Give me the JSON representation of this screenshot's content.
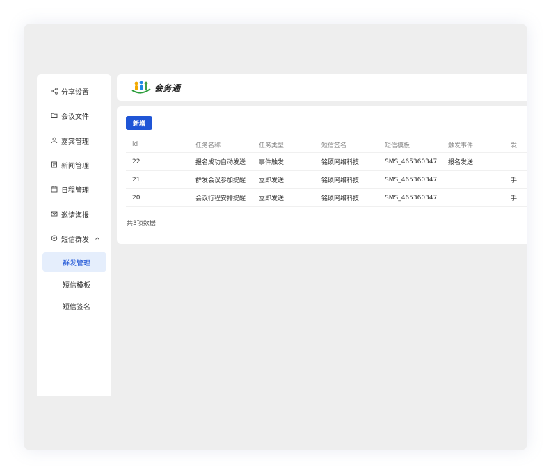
{
  "sidebar": {
    "items": [
      {
        "label": "分享设置",
        "icon": "share-icon"
      },
      {
        "label": "会议文件",
        "icon": "folder-icon"
      },
      {
        "label": "嘉宾管理",
        "icon": "user-icon"
      },
      {
        "label": "新闻管理",
        "icon": "news-icon"
      },
      {
        "label": "日程管理",
        "icon": "calendar-icon"
      },
      {
        "label": "邀请海报",
        "icon": "mail-icon"
      },
      {
        "label": "短信群发",
        "icon": "message-icon",
        "expanded": true
      }
    ],
    "subitems": [
      {
        "label": "群发管理",
        "active": true
      },
      {
        "label": "短信模板",
        "active": false
      },
      {
        "label": "短信签名",
        "active": false
      }
    ]
  },
  "header": {
    "logo_text": "会务通",
    "logo_icon": "people-logo-icon"
  },
  "toolbar": {
    "add_label": "新增"
  },
  "table": {
    "columns": [
      "id",
      "任务名称",
      "任务类型",
      "短信签名",
      "短信模板",
      "触发事件",
      "发"
    ],
    "rows": [
      [
        "22",
        "报名成功自动发送",
        "事件触发",
        "铭硕网络科技",
        "SMS_465360347",
        "报名发送",
        ""
      ],
      [
        "21",
        "群发会议参加提醒",
        "立即发送",
        "铭硕网络科技",
        "SMS_465360347",
        "",
        "手"
      ],
      [
        "20",
        "会议行程安排提醒",
        "立即发送",
        "铭硕网络科技",
        "SMS_465360347",
        "",
        "手"
      ]
    ]
  },
  "footer": {
    "count_text": "共3项数据"
  },
  "colors": {
    "primary": "#1f55d6",
    "active_bg": "#e5eefc",
    "frame_bg": "#eeeeee"
  }
}
